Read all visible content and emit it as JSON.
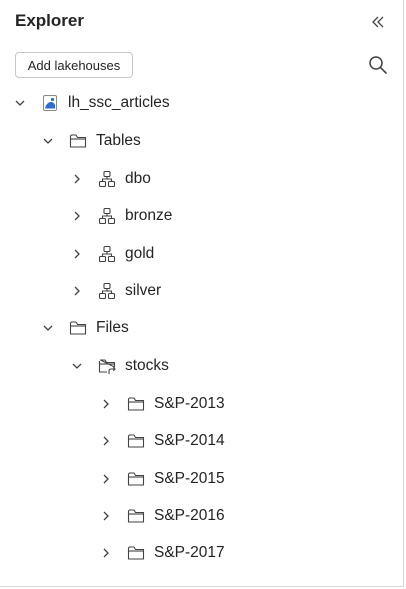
{
  "panel": {
    "title": "Explorer",
    "add_button_label": "Add lakehouses",
    "collapse_icon": "double-chevron-left-icon",
    "search_icon": "search-icon"
  },
  "tree": {
    "lakehouse": {
      "label": "lh_ssc_articles",
      "expanded": true,
      "icon": "lakehouse-icon",
      "icon_color": "#2b6dd1"
    },
    "tables": {
      "label": "Tables",
      "expanded": true,
      "icon": "folder-icon",
      "items": [
        {
          "label": "dbo",
          "icon": "schema-icon",
          "expanded": false
        },
        {
          "label": "bronze",
          "icon": "schema-icon",
          "expanded": false
        },
        {
          "label": "gold",
          "icon": "schema-icon",
          "expanded": false
        },
        {
          "label": "silver",
          "icon": "schema-icon",
          "expanded": false
        }
      ]
    },
    "files": {
      "label": "Files",
      "expanded": true,
      "icon": "folder-icon",
      "stocks": {
        "label": "stocks",
        "expanded": true,
        "icon": "folder-shortcut-icon",
        "items": [
          {
            "label": "S&P-2013",
            "icon": "folder-icon",
            "expanded": false
          },
          {
            "label": "S&P-2014",
            "icon": "folder-icon",
            "expanded": false
          },
          {
            "label": "S&P-2015",
            "icon": "folder-icon",
            "expanded": false
          },
          {
            "label": "S&P-2016",
            "icon": "folder-icon",
            "expanded": false
          },
          {
            "label": "S&P-2017",
            "icon": "folder-icon",
            "expanded": false
          }
        ]
      }
    }
  }
}
